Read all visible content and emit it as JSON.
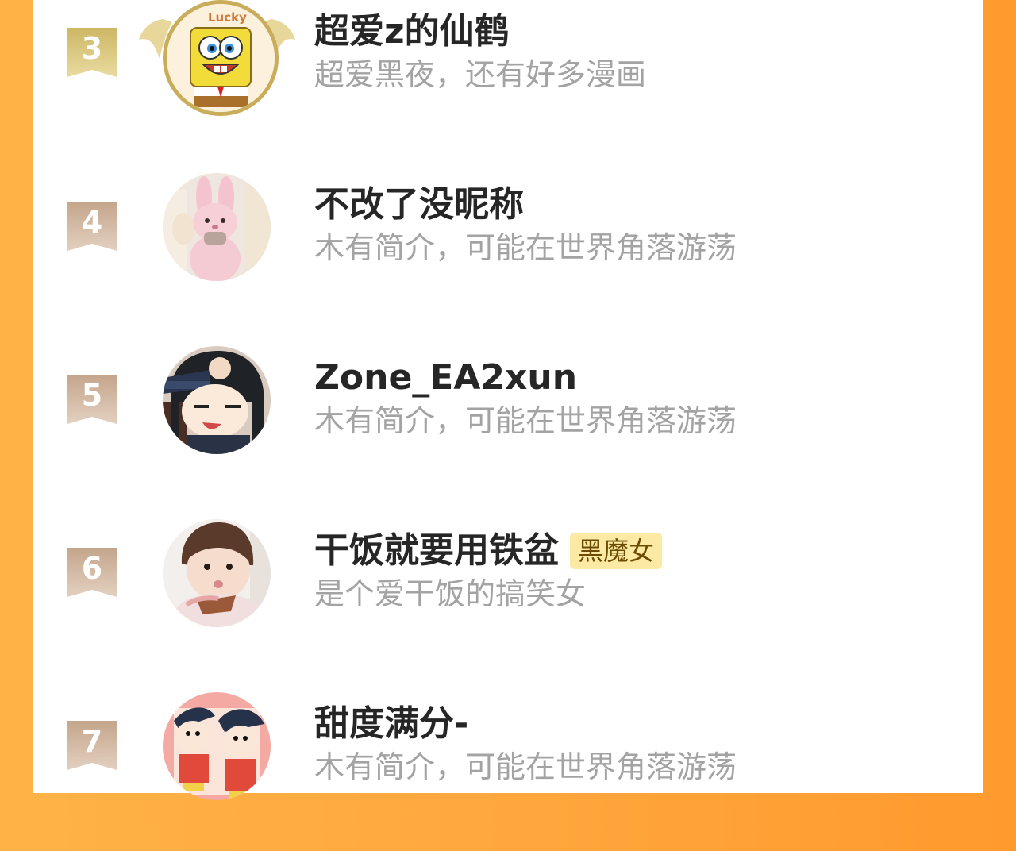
{
  "ranking": {
    "rows": [
      {
        "rank": "3",
        "name": "超爱z的仙鹤",
        "bio": "超爱黑夜，还有好多漫画",
        "tag": "",
        "avatar_text": "Lucky",
        "ribbon_color": "#c8b361",
        "avatar_icon": "spongebob-avatar-icon"
      },
      {
        "rank": "4",
        "name": "不改了没昵称",
        "bio": "木有简介，可能在世界角落游荡",
        "tag": "",
        "ribbon_color": "#c8aa92",
        "avatar_icon": "bunny-plush-avatar-icon"
      },
      {
        "rank": "5",
        "name": "Zone_EA2xun",
        "bio": "木有简介，可能在世界角落游荡",
        "tag": "",
        "ribbon_color": "#c8aa92",
        "avatar_icon": "anime-girl-avatar-icon"
      },
      {
        "rank": "6",
        "name": "干饭就要用铁盆",
        "bio": "是个爱干饭的搞笑女",
        "tag": "黑魔女",
        "ribbon_color": "#c8aa92",
        "avatar_icon": "baby-avatar-icon"
      },
      {
        "rank": "7",
        "name": "甜度满分-",
        "bio": "木有简介，可能在世界角落游荡",
        "tag": "",
        "ribbon_color": "#c8aa92",
        "avatar_icon": "cartoon-kids-avatar-icon"
      }
    ]
  },
  "colors": {
    "background": "#ffa73d",
    "panel": "#ffffff",
    "name_text": "#262626",
    "bio_text": "#a3a3a3",
    "tag_bg": "#fbe9a4",
    "gold": "#c9ad5a"
  }
}
